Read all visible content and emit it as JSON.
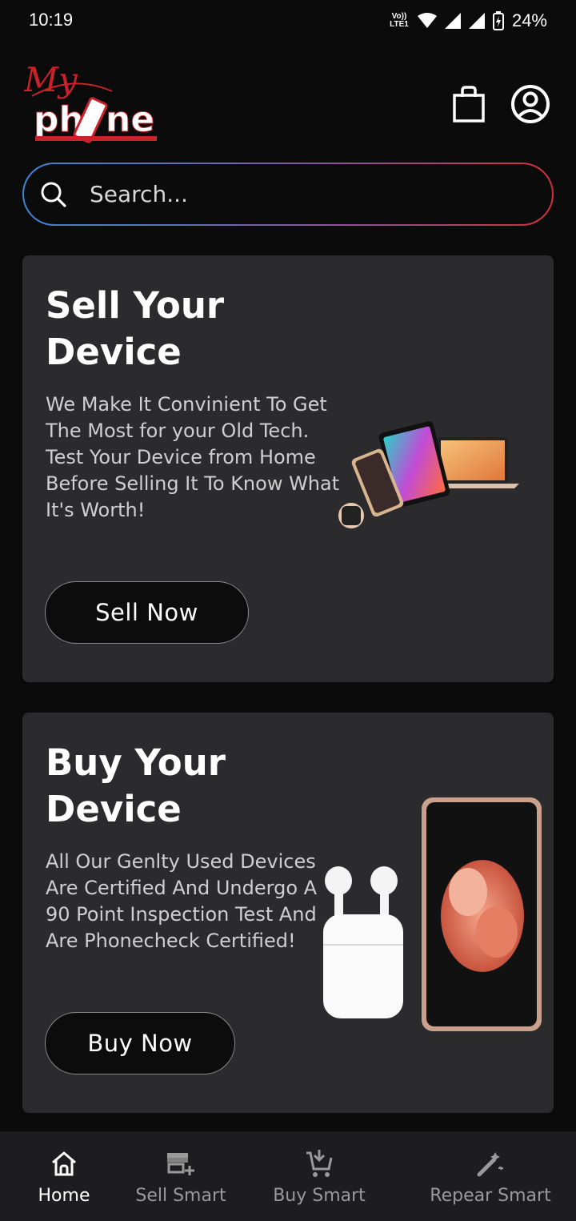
{
  "status_bar": {
    "time": "10:19",
    "volte": "Vo)) LTE1",
    "battery": "24%"
  },
  "app": {
    "logo_text_top": "My",
    "logo_text_bottom": "phone",
    "brand_red": "#d2232a"
  },
  "search": {
    "placeholder": "Search..."
  },
  "sell_card": {
    "title": "Sell Your Device",
    "description": "We Make It Convinient To Get The Most for your Old Tech. Test Your Device from Home Before Selling It To Know What It's Worth!",
    "button": "Sell Now"
  },
  "buy_card": {
    "title": "Buy Your Device",
    "description": "All Our Genlty Used Devices Are Certified And Undergo A 90 Point Inspection Test And Are Phonecheck Certified!",
    "button": "Buy Now"
  },
  "bottom_nav": {
    "items": [
      {
        "label": "Home",
        "icon": "home-icon",
        "active": true
      },
      {
        "label": "Sell Smart",
        "icon": "store-add-icon",
        "active": false
      },
      {
        "label": "Buy Smart",
        "icon": "cart-download-icon",
        "active": false
      },
      {
        "label": "Repear Smart",
        "icon": "magic-wand-icon",
        "active": false
      }
    ]
  }
}
